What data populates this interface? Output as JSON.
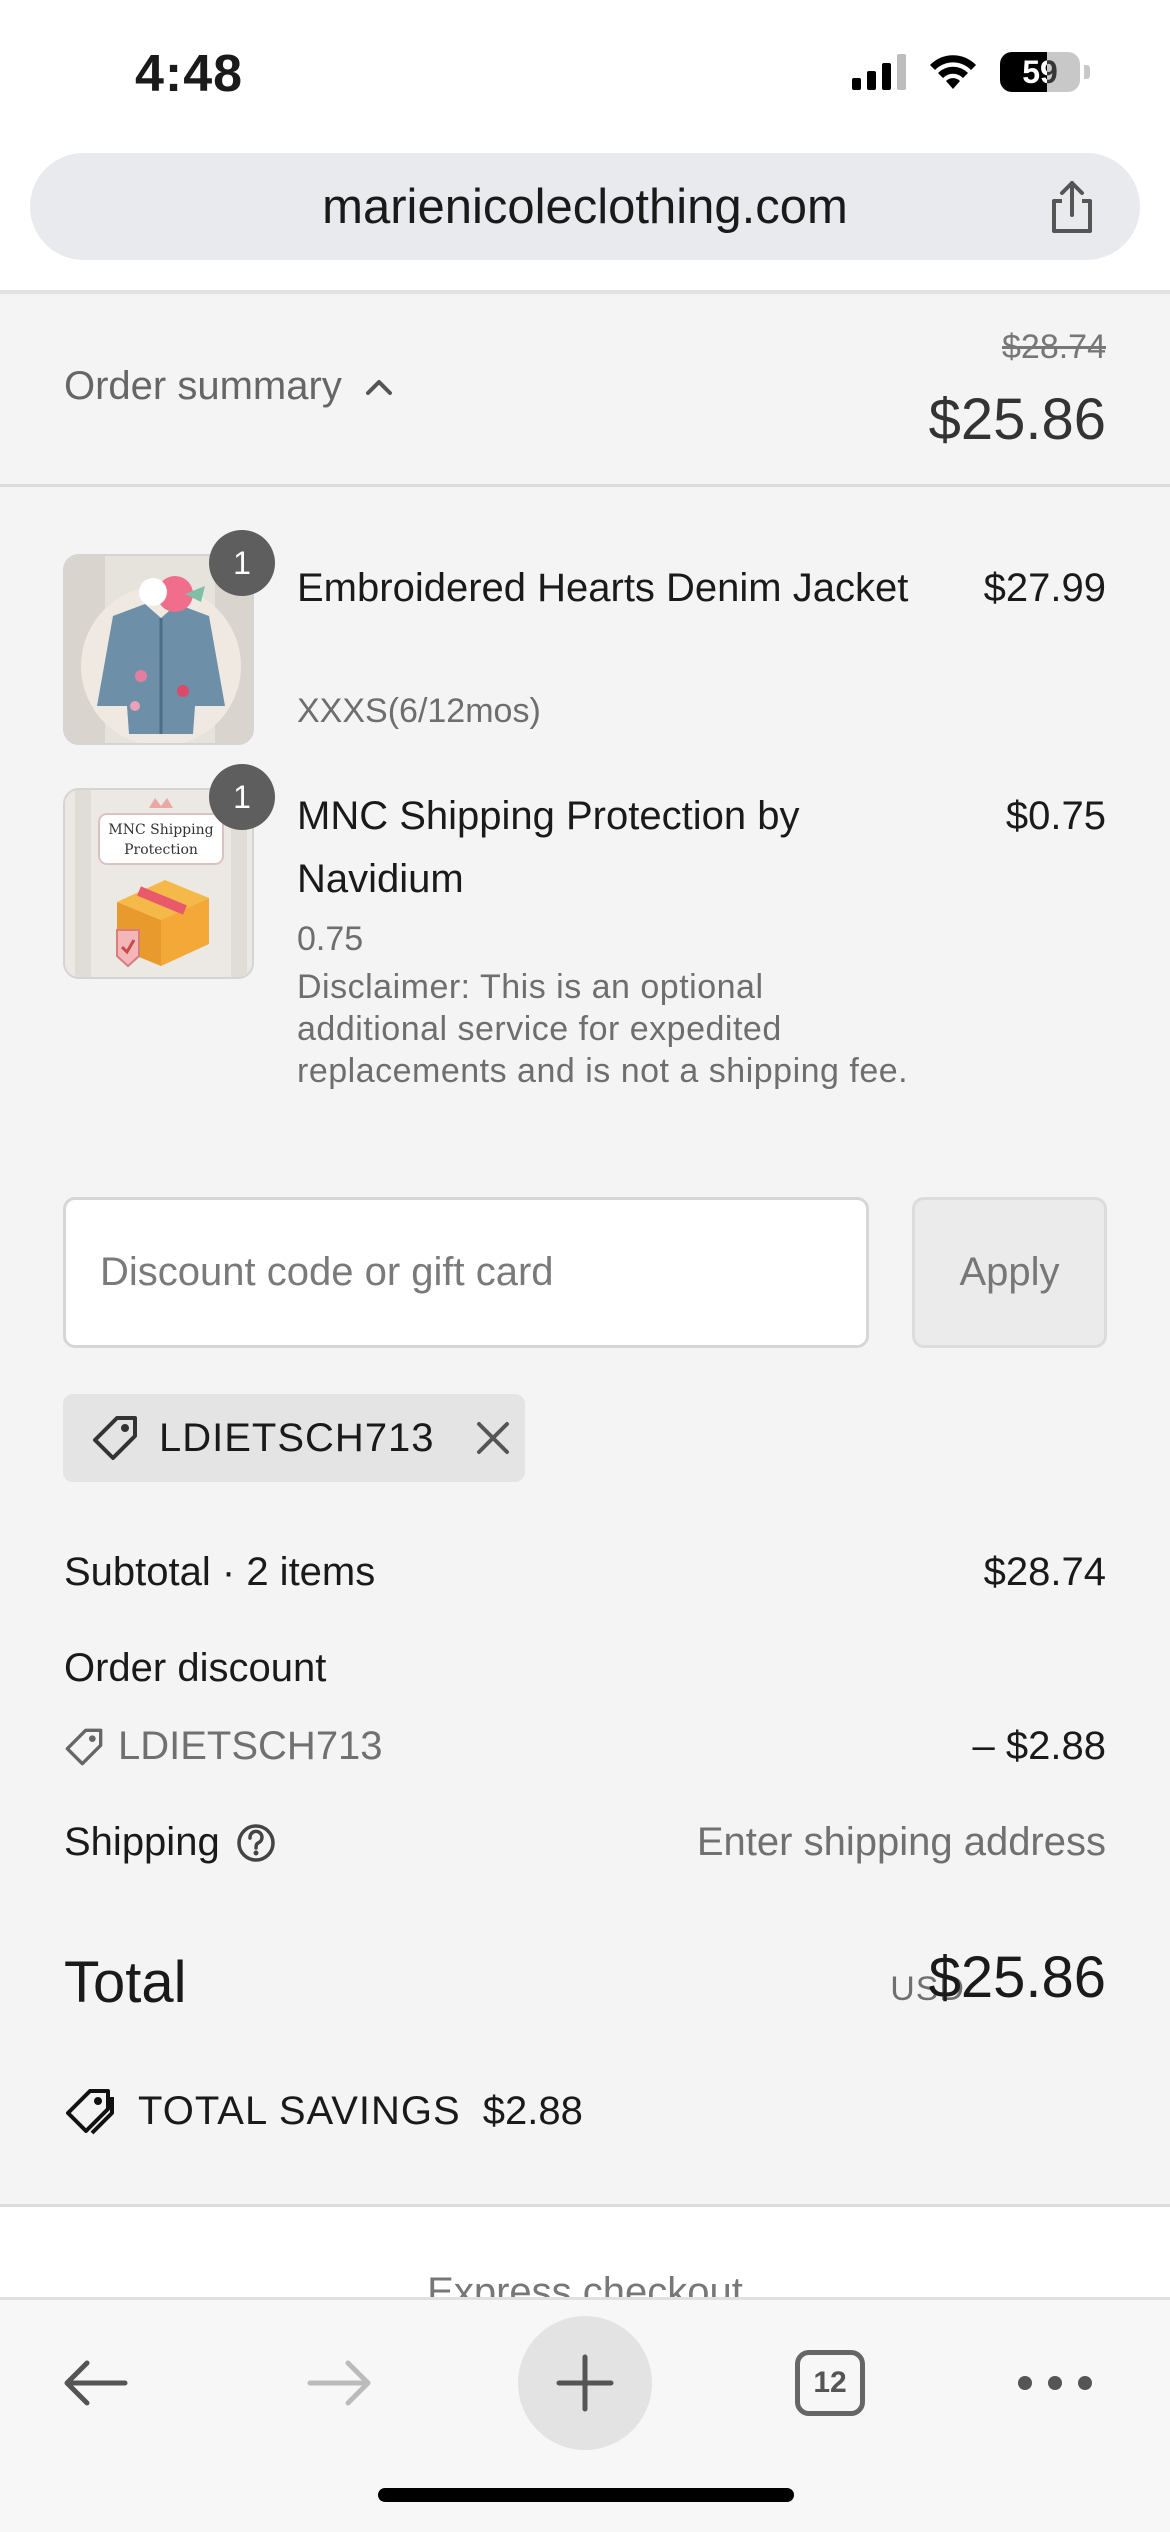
{
  "status_bar": {
    "time": "4:48",
    "battery": "59"
  },
  "browser": {
    "url": "marienicoleclothing.com"
  },
  "order_summary": {
    "toggle_label": "Order summary",
    "original_total": "$28.74",
    "total": "$25.86"
  },
  "items": [
    {
      "quantity": "1",
      "title": "Embroidered Hearts Denim Jacket",
      "variant": "XXXS(6/12mos)",
      "price": "$27.99"
    },
    {
      "quantity": "1",
      "title": "MNC Shipping Protection by Navidium",
      "variant": "0.75",
      "description": "Disclaimer: This is an optional additional service for expedited replacements and is not a shipping fee.",
      "price": "$0.75",
      "thumb_text_line1": "MNC Shipping",
      "thumb_text_line2": "Protection"
    }
  ],
  "discount": {
    "placeholder": "Discount code or gift card",
    "apply_label": "Apply",
    "applied_code": "LDIETSCH713"
  },
  "totals": {
    "subtotal_label": "Subtotal · 2 items",
    "subtotal_value": "$28.74",
    "order_discount_label": "Order discount",
    "discount_code": "LDIETSCH713",
    "discount_value": "– $2.88",
    "shipping_label": "Shipping",
    "shipping_value": "Enter shipping address",
    "total_label": "Total",
    "currency": "USD",
    "total_value": "$25.86",
    "savings_label": "TOTAL SAVINGS",
    "savings_value": "$2.88"
  },
  "express_checkout": "Express checkout",
  "toolbar": {
    "tab_count": "12"
  },
  "icons": {
    "share": "share-icon",
    "chevron": "chevron-up-icon",
    "tag": "tag-icon",
    "close": "close-icon",
    "help": "question-circle-icon",
    "back": "arrow-left-icon",
    "forward": "arrow-right-icon",
    "new_tab": "plus-icon",
    "tabs": "tabs-icon",
    "more": "more-horizontal-icon"
  }
}
